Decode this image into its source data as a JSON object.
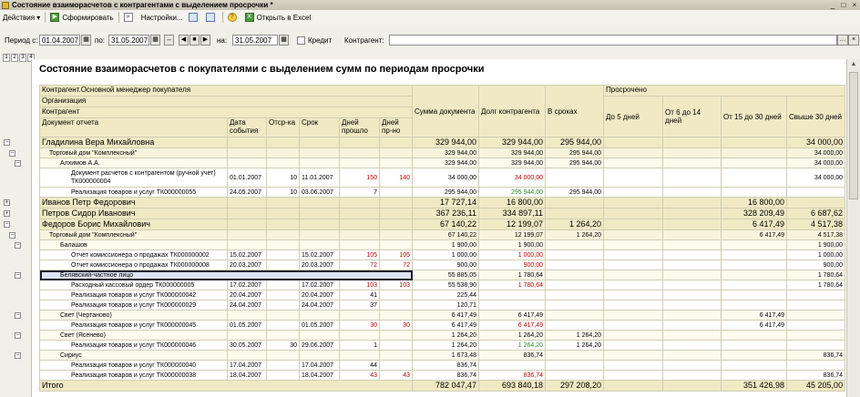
{
  "window": {
    "title": "Состояние взаиморасчетов с контрагентами с выделением просрочки *",
    "controls": [
      "_",
      "□",
      "×"
    ]
  },
  "toolbar": {
    "actions_label": "Действия",
    "generate_label": "Сформировать",
    "settings_label": "Настройки...",
    "excel_label": "Открыть в Excel"
  },
  "period": {
    "period_from_label": "Период с:",
    "period_from": "01.04.2007",
    "period_to_label": "по:",
    "period_to": "31.05.2007",
    "on_label": "на:",
    "on_date": "31.05.2007",
    "credit_label": "Кредит",
    "counterparty_label": "Контрагент:",
    "counterparty_value": ""
  },
  "report": {
    "title": "Состояние взаиморасчетов с покупателями с выделением сумм по периодам просрочки",
    "headers": {
      "group1": "Контрагент.Основной менеджер покупателя",
      "group2": "Организация",
      "group3": "Контрагент",
      "doc": "Документ отчета",
      "event_date": "Дата события",
      "delay": "Отср-ка",
      "term": "Срок",
      "days_passed": "Дней прошло",
      "days_overdue": "Дней пр-но",
      "doc_sum": "Сумма документа",
      "debt": "Долг контрагента",
      "in_term": "В сроках",
      "overdue": "Просрочено",
      "upto5": "До 5 дней",
      "d6_14": "От 6 до 14 дней",
      "d15_30": "От 15 до 30 дней",
      "over30": "Свыше 30 дней"
    },
    "rows": [
      {
        "level": "l1",
        "name": "Гладилина Вера Михайловна",
        "date": "",
        "delay": "",
        "term": "",
        "passed": "",
        "over": "",
        "sum": "329 944,00",
        "debt": "329 944,00",
        "debt_color": "",
        "in_term": "295 944,00",
        "upto5": "",
        "d6_14": "",
        "d15_30": "",
        "over30": "34 000,00"
      },
      {
        "level": "l2",
        "name": "Торговый дом \"Комплексный\"",
        "date": "",
        "delay": "",
        "term": "",
        "passed": "",
        "over": "",
        "sum": "329 944,00",
        "debt": "329 944,00",
        "debt_color": "",
        "in_term": "295 944,00",
        "upto5": "",
        "d6_14": "",
        "d15_30": "",
        "over30": "34 000,00"
      },
      {
        "level": "l3",
        "name": "Алхимов А.А.",
        "date": "",
        "delay": "",
        "term": "",
        "passed": "",
        "over": "",
        "sum": "329 944,00",
        "debt": "329 944,00",
        "debt_color": "",
        "in_term": "295 944,00",
        "upto5": "",
        "d6_14": "",
        "d15_30": "",
        "over30": "34 000,00"
      },
      {
        "level": "l4",
        "name": "Документ расчетов с контрагентом (ручной учет) ТК000000004",
        "date": "01.01.2007",
        "delay": "10",
        "term": "11.01.2007",
        "passed": "150",
        "over": "140",
        "sum": "34 000,00",
        "debt": "34 000,00",
        "debt_color": "red",
        "in_term": "",
        "upto5": "",
        "d6_14": "",
        "d15_30": "",
        "over30": "34 000,00",
        "tall": true
      },
      {
        "level": "l4",
        "name": "Реализация товаров и услуг ТК000000055",
        "date": "24.05.2007",
        "delay": "10",
        "term": "03.06.2007",
        "passed": "7",
        "over": "",
        "sum": "295 944,00",
        "debt": "295 944,00",
        "debt_color": "green",
        "in_term": "295 944,00",
        "upto5": "",
        "d6_14": "",
        "d15_30": "",
        "over30": ""
      },
      {
        "level": "l1",
        "name": "Иванов Петр Федорович",
        "date": "",
        "delay": "",
        "term": "",
        "passed": "",
        "over": "",
        "sum": "17 727,14",
        "debt": "16 800,00",
        "debt_color": "",
        "in_term": "",
        "upto5": "",
        "d6_14": "",
        "d15_30": "16 800,00",
        "over30": ""
      },
      {
        "level": "l1",
        "name": "Петров Сидор Иванович",
        "date": "",
        "delay": "",
        "term": "",
        "passed": "",
        "over": "",
        "sum": "367 236,11",
        "debt": "334 897,11",
        "debt_color": "",
        "in_term": "",
        "upto5": "",
        "d6_14": "",
        "d15_30": "328 209,49",
        "over30": "6 687,62"
      },
      {
        "level": "l1",
        "name": "Федоров Борис Михайлович",
        "date": "",
        "delay": "",
        "term": "",
        "passed": "",
        "over": "",
        "sum": "67 140,22",
        "debt": "12 199,07",
        "debt_color": "",
        "in_term": "1 264,20",
        "upto5": "",
        "d6_14": "",
        "d15_30": "6 417,49",
        "over30": "4 517,38"
      },
      {
        "level": "l2",
        "name": "Торговый дом \"Комплексный\"",
        "date": "",
        "delay": "",
        "term": "",
        "passed": "",
        "over": "",
        "sum": "67 140,22",
        "debt": "12 199,07",
        "debt_color": "",
        "in_term": "1 264,20",
        "upto5": "",
        "d6_14": "",
        "d15_30": "6 417,49",
        "over30": "4 517,38"
      },
      {
        "level": "l3",
        "name": "Балашов",
        "date": "",
        "delay": "",
        "term": "",
        "passed": "",
        "over": "",
        "sum": "1 900,00",
        "debt": "1 900,00",
        "debt_color": "",
        "in_term": "",
        "upto5": "",
        "d6_14": "",
        "d15_30": "",
        "over30": "1 900,00"
      },
      {
        "level": "l4",
        "name": "Отчет комиссионера о продажах ТК000000002",
        "date": "15.02.2007",
        "delay": "",
        "term": "15.02.2007",
        "passed": "105",
        "over": "105",
        "sum": "1 000,00",
        "debt": "1 000,00",
        "debt_color": "red",
        "in_term": "",
        "upto5": "",
        "d6_14": "",
        "d15_30": "",
        "over30": "1 000,00"
      },
      {
        "level": "l4",
        "name": "Отчет комиссионера о продажах ТК000000008",
        "date": "20.03.2007",
        "delay": "",
        "term": "20.03.2007",
        "passed": "72",
        "over": "72",
        "sum": "900,00",
        "debt": "900,00",
        "debt_color": "red",
        "in_term": "",
        "upto5": "",
        "d6_14": "",
        "d15_30": "",
        "over30": "900,00"
      },
      {
        "level": "l3",
        "name": "Белявский-частное лицо",
        "date": "",
        "delay": "",
        "term": "",
        "passed": "",
        "over": "",
        "sum": "55 885,05",
        "debt": "1 780,64",
        "debt_color": "",
        "in_term": "",
        "upto5": "",
        "d6_14": "",
        "d15_30": "",
        "over30": "1 780,64",
        "selected": true
      },
      {
        "level": "l4",
        "name": "Расходный кассовый ордер ТК000000005",
        "date": "17.02.2007",
        "delay": "",
        "term": "17.02.2007",
        "passed": "103",
        "over": "103",
        "sum": "55 538,90",
        "debt": "1 780,64",
        "debt_color": "red",
        "in_term": "",
        "upto5": "",
        "d6_14": "",
        "d15_30": "",
        "over30": "1 780,64"
      },
      {
        "level": "l4",
        "name": "Реализация товаров и услуг ТК000000042",
        "date": "20.04.2007",
        "delay": "",
        "term": "20.04.2007",
        "passed": "41",
        "over": "",
        "sum": "225,44",
        "debt": "",
        "debt_color": "",
        "in_term": "",
        "upto5": "",
        "d6_14": "",
        "d15_30": "",
        "over30": ""
      },
      {
        "level": "l4",
        "name": "Реализация товаров и услуг ТК000000029",
        "date": "24.04.2007",
        "delay": "",
        "term": "24.04.2007",
        "passed": "37",
        "over": "",
        "sum": "120,71",
        "debt": "",
        "debt_color": "",
        "in_term": "",
        "upto5": "",
        "d6_14": "",
        "d15_30": "",
        "over30": ""
      },
      {
        "level": "l3",
        "name": "Свет (Чертаново)",
        "date": "",
        "delay": "",
        "term": "",
        "passed": "",
        "over": "",
        "sum": "6 417,49",
        "debt": "6 417,49",
        "debt_color": "",
        "in_term": "",
        "upto5": "",
        "d6_14": "",
        "d15_30": "6 417,49",
        "over30": ""
      },
      {
        "level": "l4",
        "name": "Реализация товаров и услуг ТК000000045",
        "date": "01.05.2007",
        "delay": "",
        "term": "01.05.2007",
        "passed": "30",
        "over": "30",
        "sum": "6 417,49",
        "debt": "6 417,49",
        "debt_color": "red",
        "in_term": "",
        "upto5": "",
        "d6_14": "",
        "d15_30": "6 417,49",
        "over30": ""
      },
      {
        "level": "l3",
        "name": "Свет (Ясенево)",
        "date": "",
        "delay": "",
        "term": "",
        "passed": "",
        "over": "",
        "sum": "1 264,20",
        "debt": "1 264,20",
        "debt_color": "",
        "in_term": "1 264,20",
        "upto5": "",
        "d6_14": "",
        "d15_30": "",
        "over30": ""
      },
      {
        "level": "l4",
        "name": "Реализация товаров и услуг ТК000000046",
        "date": "30.05.2007",
        "delay": "30",
        "term": "29.06.2007",
        "passed": "1",
        "over": "",
        "sum": "1 264,20",
        "debt": "1 264,20",
        "debt_color": "green",
        "in_term": "1 264,20",
        "upto5": "",
        "d6_14": "",
        "d15_30": "",
        "over30": ""
      },
      {
        "level": "l3",
        "name": "Сириус",
        "date": "",
        "delay": "",
        "term": "",
        "passed": "",
        "over": "",
        "sum": "1 673,48",
        "debt": "836,74",
        "debt_color": "",
        "in_term": "",
        "upto5": "",
        "d6_14": "",
        "d15_30": "",
        "over30": "836,74"
      },
      {
        "level": "l4",
        "name": "Реализация товаров и услуг ТК000000040",
        "date": "17.04.2007",
        "delay": "",
        "term": "17.04.2007",
        "passed": "44",
        "over": "",
        "sum": "836,74",
        "debt": "",
        "debt_color": "",
        "in_term": "",
        "upto5": "",
        "d6_14": "",
        "d15_30": "",
        "over30": ""
      },
      {
        "level": "l4",
        "name": "Реализация товаров и услуг ТК000000038",
        "date": "18.04.2007",
        "delay": "",
        "term": "18.04.2007",
        "passed": "43",
        "over": "43",
        "sum": "836,74",
        "debt": "836,74",
        "debt_color": "red",
        "in_term": "",
        "upto5": "",
        "d6_14": "",
        "d15_30": "",
        "over30": "836,74"
      }
    ],
    "total": {
      "name": "Итого",
      "sum": "782 047,47",
      "debt": "693 840,18",
      "in_term": "297 208,20",
      "upto5": "",
      "d6_14": "",
      "d15_30": "351 426,98",
      "over30": "45 205,00"
    }
  }
}
